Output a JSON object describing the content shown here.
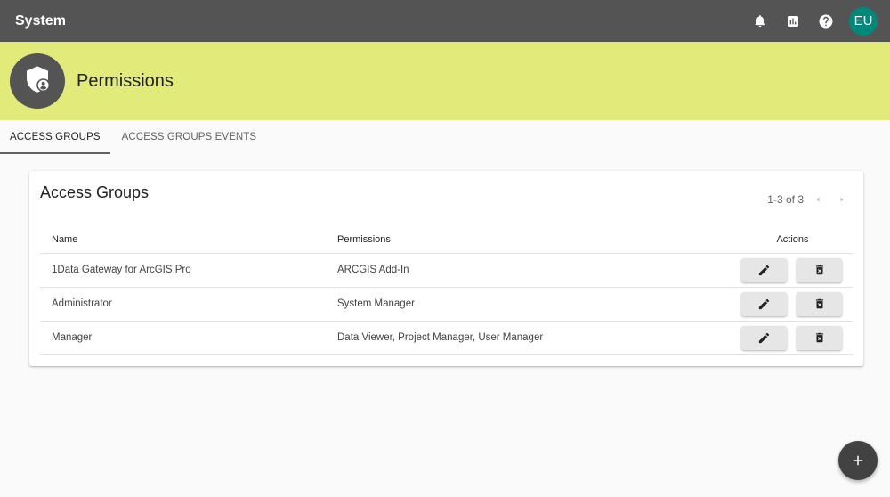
{
  "app": {
    "title": "System"
  },
  "topbar": {
    "icons": [
      "bell-icon",
      "bar-chart-icon",
      "help-icon"
    ],
    "avatar_initials": "EU",
    "avatar_color": "#00897b"
  },
  "banner": {
    "title": "Permissions",
    "icon": "shield-user-icon",
    "color": "#e2eb79"
  },
  "tabs": [
    {
      "label": "ACCESS GROUPS",
      "active": true
    },
    {
      "label": "ACCESS GROUPS EVENTS",
      "active": false
    }
  ],
  "card": {
    "title": "Access Groups",
    "pager": {
      "range": "1-3 of 3"
    },
    "columns": {
      "name": "Name",
      "permissions": "Permissions",
      "actions": "Actions"
    },
    "rows": [
      {
        "name": "1Data Gateway for ArcGIS Pro",
        "permissions": "ARCGIS Add-In"
      },
      {
        "name": "Administrator",
        "permissions": "System Manager"
      },
      {
        "name": "Manager",
        "permissions": "Data Viewer, Project Manager, User Manager"
      }
    ]
  },
  "fab": {
    "icon": "add-icon"
  }
}
